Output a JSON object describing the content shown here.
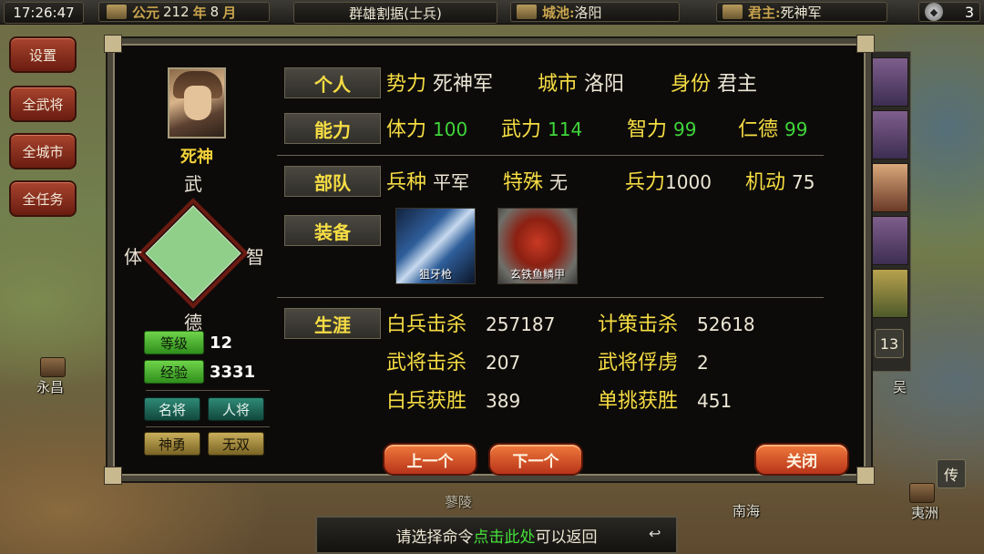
{
  "topbar": {
    "time": "17:26:47",
    "year_era": "公元",
    "year_num": "212",
    "year_unit": "年",
    "month_num": "8",
    "month_unit": "月",
    "scenario": "群雄割据(士兵)",
    "city_label": "城池:",
    "city_value": "洛阳",
    "lord_label": "君主:",
    "lord_value": "死神军",
    "turn_count": "3"
  },
  "left_menu": [
    "设置",
    "全武将",
    "全城市",
    "全任务"
  ],
  "map_labels": [
    "永昌",
    "南海",
    "夷洲",
    "吴",
    "传",
    "蓼陵"
  ],
  "strip_badge": "13",
  "hero": {
    "name": "死神",
    "stat_top": "武",
    "stat_left": "体",
    "stat_right": "智",
    "stat_bottom": "德",
    "level_label": "等级",
    "level": "12",
    "exp_label": "经验",
    "exp": "3331",
    "tags": [
      "名将",
      "人将",
      "神勇",
      "无双"
    ]
  },
  "personal": {
    "section": "个人",
    "faction_label": "势力",
    "faction": "死神军",
    "city_label": "城市",
    "city": "洛阳",
    "identity_label": "身份",
    "identity": "君主"
  },
  "ability": {
    "section": "能力",
    "stamina_label": "体力",
    "stamina": "100",
    "force_label": "武力",
    "force": "114",
    "intellect_label": "智力",
    "intellect": "99",
    "virtue_label": "仁德",
    "virtue": "99"
  },
  "troops": {
    "section": "部队",
    "type_label": "兵种",
    "type": "平军",
    "special_label": "特殊",
    "special": "无",
    "strength_label": "兵力",
    "strength": "1000",
    "mobility_label": "机动",
    "mobility": "75"
  },
  "equipment": {
    "section": "装备",
    "weapon": "狙牙枪",
    "armor": "玄铁鱼鳞甲"
  },
  "career": {
    "section": "生涯",
    "rows": [
      {
        "label": "白兵击杀",
        "value": "257187",
        "label2": "计策击杀",
        "value2": "52618"
      },
      {
        "label": "武将击杀",
        "value": "207",
        "label2": "武将俘虏",
        "value2": "2"
      },
      {
        "label": "白兵获胜",
        "value": "389",
        "label2": "单挑获胜",
        "value2": "451"
      }
    ]
  },
  "buttons": {
    "prev": "上一个",
    "next": "下一个",
    "close": "关闭"
  },
  "prompt": {
    "before": "请选择命令",
    "highlight": "点击此处",
    "after": "可以返回"
  },
  "colors": {
    "section_text": "#f6dd44",
    "stat_green": "#3fd53a",
    "button_orange": "#e25a2a",
    "menu_red": "#8a2c1c"
  }
}
